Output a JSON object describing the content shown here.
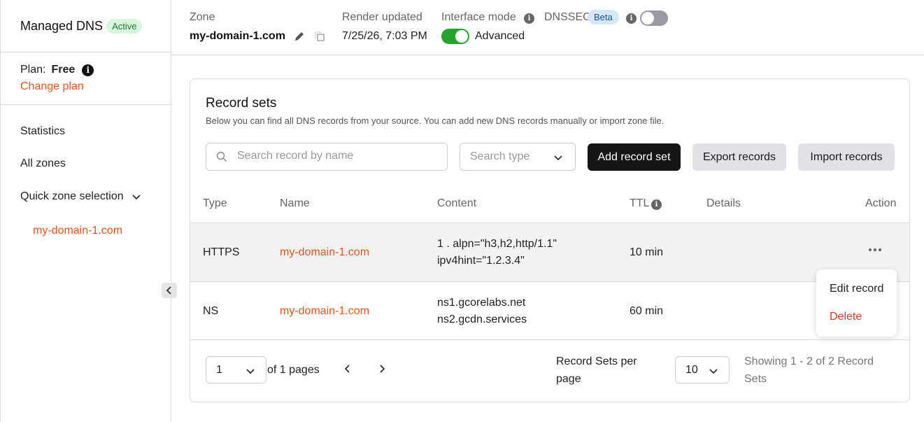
{
  "sidebar": {
    "title": "Managed DNS",
    "status_badge": "Active",
    "plan_label": "Plan:",
    "plan_value": "Free",
    "change_plan": "Change plan",
    "nav": {
      "statistics": "Statistics",
      "all_zones": "All zones",
      "quick_zone": "Quick zone selection"
    },
    "selected_zone": "my-domain-1.com"
  },
  "topbar": {
    "zone_label": "Zone",
    "zone_value": "my-domain-1.com",
    "render_label": "Render updated",
    "render_value": "7/25/26, 7:03 PM",
    "mode_label": "Interface mode",
    "mode_value": "Advanced",
    "mode_enabled": true,
    "dnssec_label": "DNSSEC",
    "dnssec_badge": "Beta",
    "dnssec_enabled": false
  },
  "records": {
    "title": "Record sets",
    "description": "Below you can find all DNS records from your source. You can add new DNS records manually or import zone file.",
    "search_placeholder": "Search record by name",
    "type_placeholder": "Search type",
    "add_button": "Add record set",
    "export_button": "Export records",
    "import_button": "Import records",
    "columns": {
      "type": "Type",
      "name": "Name",
      "content": "Content",
      "ttl": "TTL",
      "details": "Details",
      "action": "Action"
    },
    "rows": [
      {
        "type": "HTTPS",
        "name": "my-domain-1.com",
        "content": [
          "1 . alpn=\"h3,h2,http/1.1\"",
          "ipv4hint=\"1.2.3.4\""
        ],
        "ttl": "10 min"
      },
      {
        "type": "NS",
        "name": "my-domain-1.com",
        "content": [
          "ns1.gcorelabs.net",
          "ns2.gcdn.services"
        ],
        "ttl": "60 min"
      }
    ],
    "action_menu": {
      "edit": "Edit record",
      "delete": "Delete"
    },
    "pagination": {
      "page": "1",
      "of_pages": "of 1 pages",
      "per_page_label": "Record Sets per page",
      "per_page": "10",
      "showing": "Showing 1 - 2 of 2 Record Sets"
    }
  },
  "colors": {
    "accent": "#e8541a",
    "toggle_on": "#24a32f",
    "danger": "#d7392b"
  }
}
